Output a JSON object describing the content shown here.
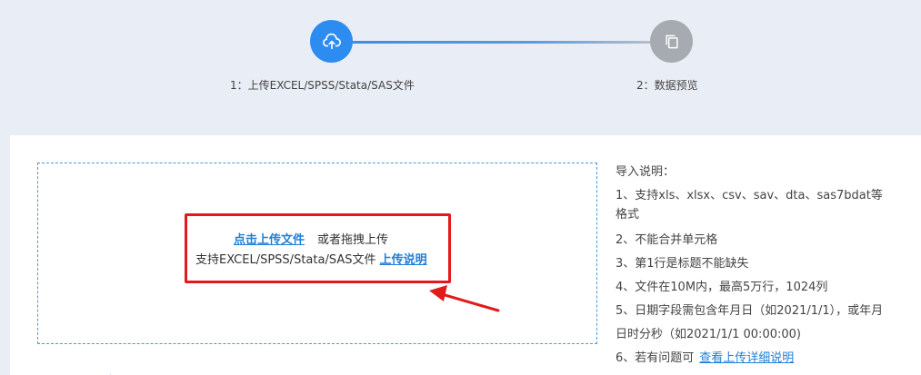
{
  "steps": [
    {
      "label": "1：上传EXCEL/SPSS/Stata/SAS文件",
      "icon": "cloud-upload-icon",
      "state": "active"
    },
    {
      "label": "2：数据预览",
      "icon": "copy-icon",
      "state": "inactive"
    }
  ],
  "upload": {
    "click_upload": "点击上传文件",
    "or_drag": "或者拖拽上传",
    "supported_formats": "支持EXCEL/SPSS/Stata/SAS文件",
    "upload_help_link": "上传说明"
  },
  "instructions": {
    "title": "导入说明：",
    "items": [
      "1、支持xls、xlsx、csv、sav、dta、sas7bdat等格式",
      "2、不能合并单元格",
      "3、第1行是标题不能缺失",
      "4、文件在10M内，最高5万行，1024列",
      "5、日期字段需包含年月日（如2021/1/1），或年月日时分秒（如2021/1/1 00:00:00)",
      "6、若有问题可"
    ],
    "detail_link": "查看上传详细说明"
  },
  "colors": {
    "primary": "#2d8cf0",
    "inactive": "#a7abb1",
    "highlight_border": "#e11b1b",
    "link": "#1f7fd6",
    "page_bg": "#e9edf5"
  }
}
